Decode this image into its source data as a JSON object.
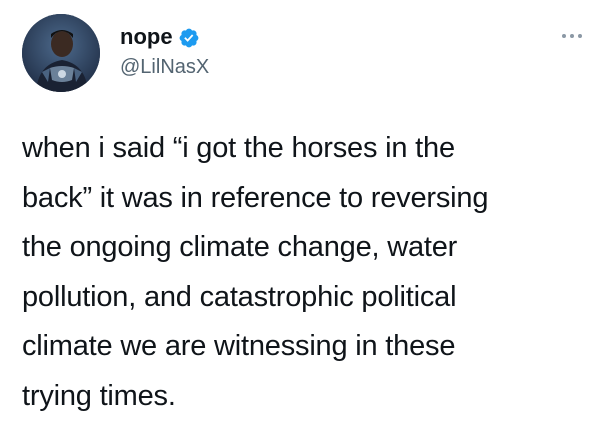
{
  "author": {
    "display_name": "nope",
    "handle": "@LilNasX",
    "verified": true,
    "avatar_icon": "user-avatar-photo",
    "verified_icon": "verified-badge-icon",
    "verified_color": "#1d9bf0"
  },
  "menu": {
    "icon": "more-options-icon"
  },
  "tweet": {
    "lines": [
      "when i said “i got the horses in the",
      "back” it was in reference to reversing",
      "the ongoing climate change, water",
      "pollution, and catastrophic political",
      "climate we are witnessing in these",
      "trying times."
    ]
  },
  "colors": {
    "text": "#0f1419",
    "secondary_text": "#536471",
    "background": "#ffffff"
  }
}
